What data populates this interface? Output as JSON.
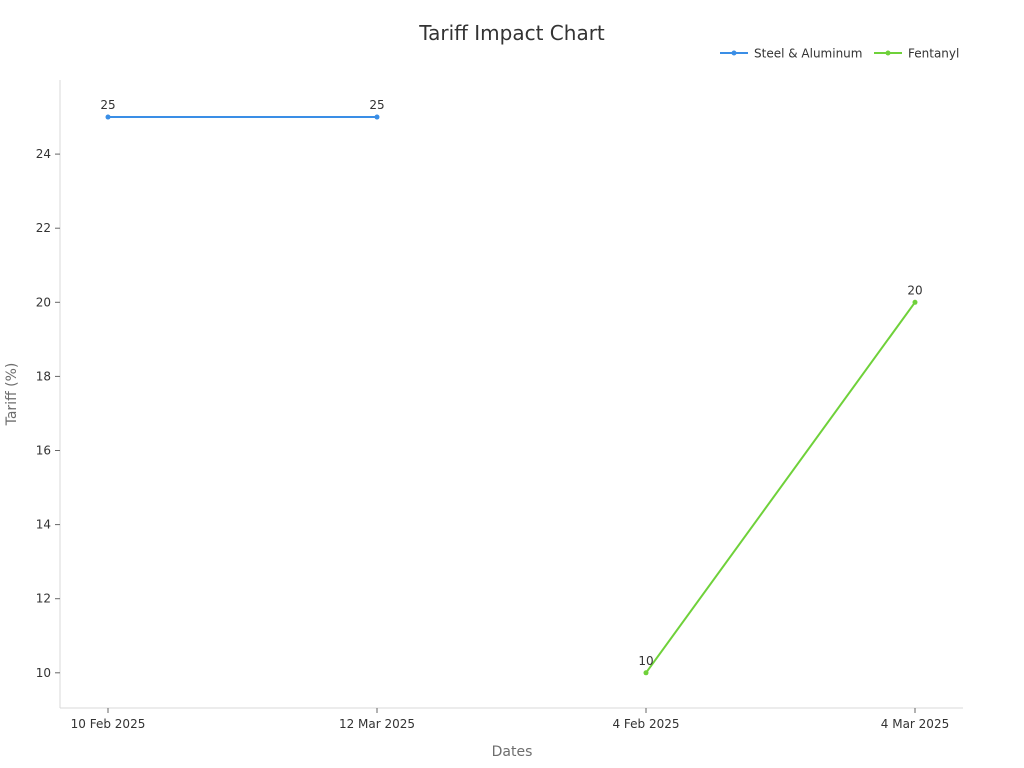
{
  "chart_data": {
    "type": "line",
    "title": "Tariff Impact Chart",
    "xlabel": "Dates",
    "ylabel": "Tariff (%)",
    "categories": [
      "10 Feb 2025",
      "12 Mar 2025",
      "4 Feb 2025",
      "4 Mar 2025"
    ],
    "series": [
      {
        "name": "Steel & Aluminum",
        "color": "#3a8ee6",
        "values": [
          25,
          25,
          null,
          null
        ]
      },
      {
        "name": "Fentanyl",
        "color": "#6fd13a",
        "values": [
          null,
          null,
          10,
          20
        ]
      }
    ],
    "yticks": [
      10,
      12,
      14,
      16,
      18,
      20,
      22,
      24
    ],
    "ylim": [
      9.05,
      26
    ],
    "grid": false,
    "legend_position": "top-right"
  }
}
